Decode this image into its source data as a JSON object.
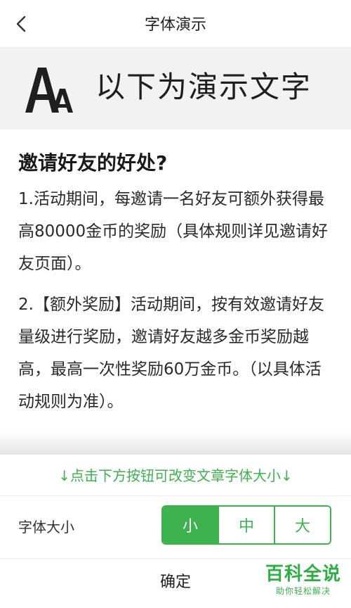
{
  "nav": {
    "title": "字体演示"
  },
  "banner": {
    "icon": "font-size-aa-icon",
    "text": "以下为演示文字"
  },
  "article": {
    "title": "邀请好友的好处?",
    "paragraphs": [
      "1.活动期间，每邀请一名好友可额外获得最高80000金币的奖励（具体规则详见邀请好友页面）。",
      "2.【额外奖励】活动期间，按有效邀请好友量级进行奖励，邀请好友越多金币奖励越高，最高一次性奖励60万金币。（以具体活动规则为准）。"
    ]
  },
  "panel": {
    "hint": "↓点击下方按钮可改变文章字体大小↓",
    "size_label": "字体大小",
    "sizes": [
      "小",
      "中",
      "大"
    ],
    "selected_size": "小",
    "confirm_label": "确定"
  },
  "watermark": {
    "main": "百科全说",
    "sub": "助你轻松解决"
  },
  "colors": {
    "accent": "#3db24e",
    "banner_bg": "#f2f2f2",
    "text": "#2a2a2a"
  }
}
